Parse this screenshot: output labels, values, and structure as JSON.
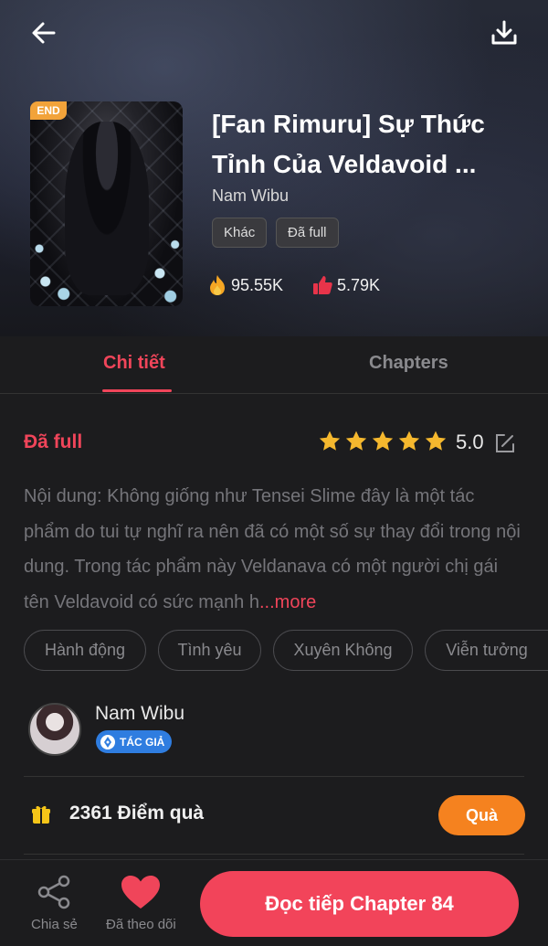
{
  "book": {
    "title": "[Fan Rimuru] Sự Thức Tỉnh Của Veldavoid ...",
    "author": "Nam Wibu",
    "end_badge": "END",
    "tags": [
      "Khác",
      "Đã full"
    ],
    "views": "95.55K",
    "likes": "5.79K"
  },
  "tabs": [
    {
      "label": "Chi tiết",
      "active": true
    },
    {
      "label": "Chapters",
      "active": false
    }
  ],
  "detail": {
    "status": "Đã full",
    "rating": "5.0",
    "stars_filled": 5,
    "description": "Nội dung: Không giống như Tensei Slime đây là một tác phẩm do tui tự nghĩ ra nên đã có một số sự thay đổi trong nội dung. Trong tác phẩm này Veldanava có một người chị gái tên Veldavoid có sức mạnh h",
    "more_label": "...more",
    "genres": [
      "Hành động",
      "Tình yêu",
      "Xuyên Không",
      "Viễn tưởng"
    ]
  },
  "author_card": {
    "name": "Nam Wibu",
    "badge": "TÁC GIẢ"
  },
  "gift": {
    "points": "2361 Điểm quà",
    "button": "Quà"
  },
  "bottom_bar": {
    "share_label": "Chia sẻ",
    "follow_label": "Đã theo dõi",
    "read_label": "Đọc tiếp Chapter 84"
  },
  "colors": {
    "accent": "#f0455a",
    "gift_button": "#f5821f",
    "star": "#f5b82e",
    "badge_blue": "#2f7de0",
    "end_badge": "#f2a33a"
  }
}
